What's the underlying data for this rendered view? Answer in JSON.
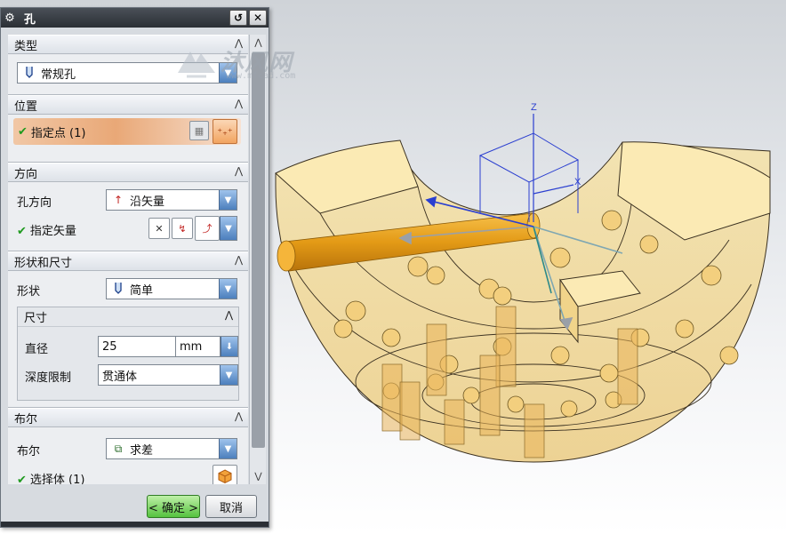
{
  "dialog": {
    "title": "孔",
    "reset_label": "↺",
    "close_label": "✕"
  },
  "sections": {
    "type": {
      "header": "类型",
      "value": "常规孔"
    },
    "position": {
      "header": "位置",
      "point_label": "指定点 (1)"
    },
    "direction": {
      "header": "方向",
      "hole_dir_label": "孔方向",
      "hole_dir_value": "沿矢量",
      "vector_label": "指定矢量"
    },
    "shape": {
      "header": "形状和尺寸",
      "shape_label": "形状",
      "shape_value": "简单",
      "dims": {
        "header": "尺寸",
        "diameter_label": "直径",
        "diameter_value": "25",
        "diameter_unit": "mm",
        "depth_label": "深度限制",
        "depth_value": "贯通体"
      }
    },
    "boolean": {
      "header": "布尔",
      "bool_label": "布尔",
      "bool_value": "求差",
      "select_body_label": "选择体 (1)"
    }
  },
  "buttons": {
    "ok": "< 确定 >",
    "cancel": "取消"
  },
  "viewport": {
    "watermark_text": "沐风网",
    "watermark_url": "www.mfcad.com",
    "axis_x": "X",
    "axis_z": "Z"
  },
  "colors": {
    "titlebar": "#2b2f35",
    "section_header": "#dde2e8",
    "accent_orange": "#e9a877",
    "ok_green": "#55c23f",
    "dropdown_blue": "#4c7fbd",
    "model_fill": "#f5d98c",
    "cylinder_orange": "#e6a21c",
    "axis_blue": "#2b3fd0"
  },
  "icons": {
    "gear": "gear-icon",
    "hole_type": "drill-hole-icon",
    "point_constructor": "point-constructor-icon",
    "vector": "vector-arrow-icon",
    "shape": "hole-shape-icon",
    "boolean": "boolean-subtract-icon",
    "body": "solid-body-icon"
  }
}
